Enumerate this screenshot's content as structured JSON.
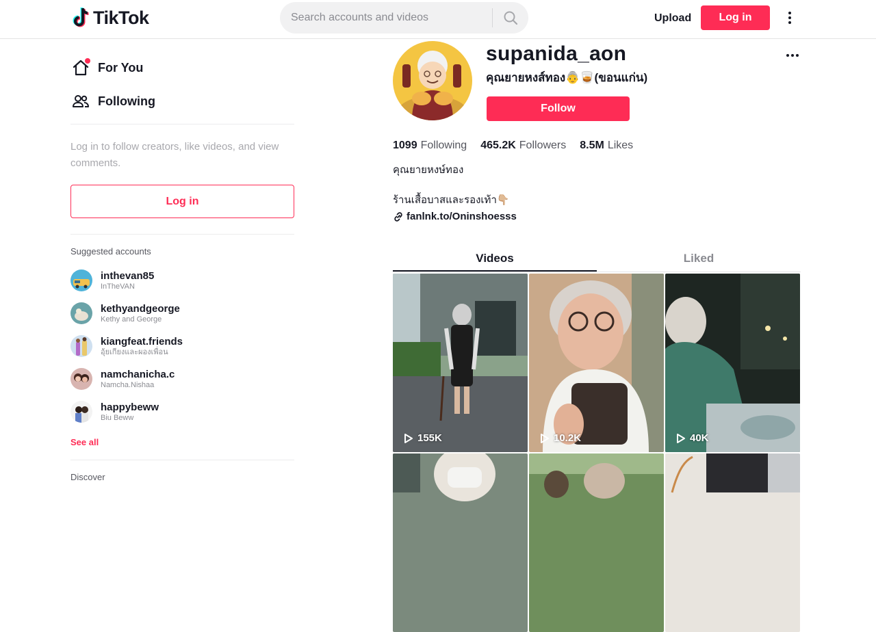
{
  "header": {
    "brand": "TikTok",
    "search_placeholder": "Search accounts and videos",
    "upload_label": "Upload",
    "login_label": "Log in"
  },
  "sidebar": {
    "nav": [
      {
        "label": "For You",
        "icon": "home-icon"
      },
      {
        "label": "Following",
        "icon": "people-icon"
      }
    ],
    "login_hint": "Log in to follow creators, like videos, and view comments.",
    "login_label": "Log in",
    "suggested_title": "Suggested accounts",
    "suggested": [
      {
        "username": "inthevan85",
        "name": "InTheVAN"
      },
      {
        "username": "kethyandgeorge",
        "name": "Kethy and George"
      },
      {
        "username": "kiangfeat.friends",
        "name": "อุ้ยเกียงและผองเพื่อน"
      },
      {
        "username": "namchanicha.c",
        "name": "Namcha.Nishaa"
      },
      {
        "username": "happybeww",
        "name": "Biu Beww"
      }
    ],
    "see_all": "See all",
    "discover": "Discover"
  },
  "profile": {
    "username": "supanida_aon",
    "display_name": "คุณยายหงส์ทอง👵🥃(ขอนแก่น)",
    "follow_label": "Follow",
    "stats": {
      "following": "1099",
      "following_label": "Following",
      "followers": "465.2K",
      "followers_label": "Followers",
      "likes": "8.5M",
      "likes_label": "Likes"
    },
    "bio_name": "คุณยายหงษ์ทอง",
    "bio_text": "ร้านเสื้อบาสและรองเท้า👇🏼",
    "link": "fanlnk.to/Oninshoesss"
  },
  "tabs": {
    "videos": "Videos",
    "liked": "Liked"
  },
  "videos": [
    {
      "views": "155K"
    },
    {
      "views": "10.2K"
    },
    {
      "views": "40K"
    }
  ],
  "colors": {
    "accent": "#fe2c55",
    "text": "#161823",
    "muted": "#8a8b91"
  }
}
